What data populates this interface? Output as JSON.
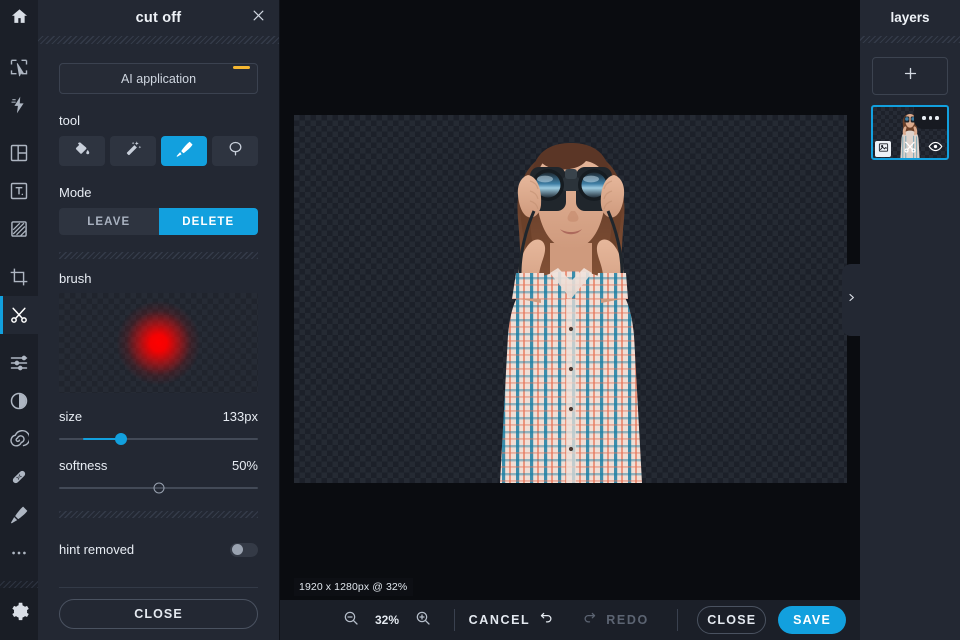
{
  "rail": {
    "home": {
      "icon": "home-icon"
    },
    "tools": [
      {
        "name": "select-tool",
        "icon": "cursor-select-icon",
        "active": false
      },
      {
        "name": "effects-tool",
        "icon": "lightning-effects-icon",
        "active": false
      },
      {
        "name": "collage-tool",
        "icon": "collage-frame-icon",
        "active": false
      },
      {
        "name": "text-tool",
        "icon": "text-box-icon",
        "active": false
      },
      {
        "name": "texture-tool",
        "icon": "texture-pattern-icon",
        "active": false
      },
      {
        "name": "crop-tool",
        "icon": "crop-icon",
        "active": false
      },
      {
        "name": "cut-off-tool",
        "icon": "scissors-icon",
        "active": true
      },
      {
        "name": "adjust-tool",
        "icon": "sliders-icon",
        "active": false
      },
      {
        "name": "contrast-tool",
        "icon": "contrast-circle-icon",
        "active": false
      },
      {
        "name": "blur-tool",
        "icon": "spiral-icon",
        "active": false
      },
      {
        "name": "heal-tool",
        "icon": "bandage-icon",
        "active": false
      },
      {
        "name": "retouch-tool",
        "icon": "paint-brush-icon",
        "active": false
      },
      {
        "name": "more-tools",
        "icon": "ellipsis-icon",
        "active": false
      }
    ],
    "settings": {
      "icon": "gear-icon"
    }
  },
  "panel": {
    "title": "cut off",
    "close_icon": "close-icon",
    "ai_button": {
      "label": "AI application",
      "badge_color": "#f5b731"
    },
    "tool_section": {
      "label": "tool",
      "items": [
        {
          "name": "fill-tool",
          "icon": "paint-bucket-icon",
          "selected": false
        },
        {
          "name": "magic-wand-tool",
          "icon": "magic-wand-icon",
          "selected": false
        },
        {
          "name": "brush-tool",
          "icon": "brush-icon",
          "selected": true
        },
        {
          "name": "lasso-tool",
          "icon": "lasso-icon",
          "selected": false
        }
      ]
    },
    "mode_section": {
      "label": "Mode",
      "options": [
        {
          "label": "LEAVE",
          "selected": false
        },
        {
          "label": "DELETE",
          "selected": true
        }
      ]
    },
    "brush_section": {
      "label": "brush",
      "preview_color": "#ff0000"
    },
    "size": {
      "label": "size",
      "value": "133px",
      "percent": 31
    },
    "softness": {
      "label": "softness",
      "value": "50%",
      "percent": 50
    },
    "hint_toggle": {
      "label": "hint removed",
      "on": false
    },
    "close_button": "CLOSE"
  },
  "stage": {
    "dimension_label": "1920 x 1280px @ 32%",
    "collapse_icon": "chevron-right-icon"
  },
  "bottombar": {
    "zoom_out_icon": "zoom-out-icon",
    "zoom_value": "32%",
    "zoom_in_icon": "zoom-in-icon",
    "cancel": {
      "label": "CANCEL",
      "icon": "undo-arrow-icon",
      "disabled": false
    },
    "redo": {
      "label": "REDO",
      "icon": "redo-arrow-icon",
      "disabled": true
    },
    "close_button": "CLOSE",
    "save_button": "SAVE"
  },
  "layers": {
    "title": "layers",
    "add_icon": "plus-icon",
    "items": [
      {
        "name": "layer-1",
        "selected": true,
        "menu_icon": "ellipsis-icon",
        "image_icon": "image-icon",
        "cut_icon": "scissors-icon",
        "visibility_icon": "eye-icon"
      }
    ]
  },
  "colors": {
    "accent": "#12a0de",
    "panel_bg": "#232833",
    "rail_bg": "#1b1f28",
    "stage_bg": "#0a0c10",
    "badge": "#f5b731",
    "brush": "#ff0000"
  }
}
